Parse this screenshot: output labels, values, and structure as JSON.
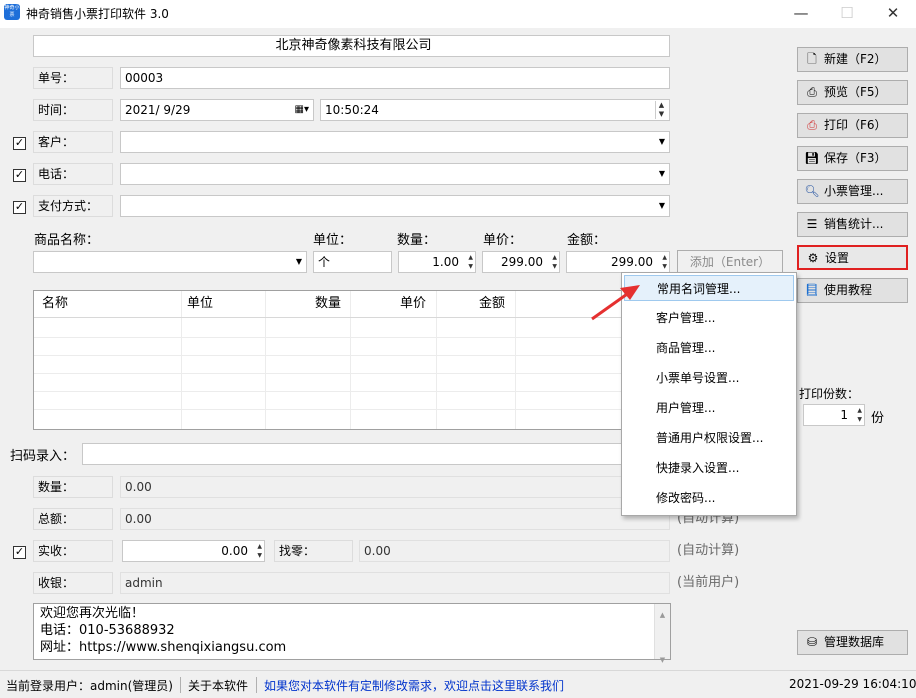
{
  "window": {
    "title": "神奇销售小票打印软件 3.0",
    "icon_label": "神奇小票",
    "minimize": "—",
    "maximize": "☐",
    "close": "✕"
  },
  "form": {
    "company": "北京神奇像素科技有限公司",
    "order_no_label": "单号：",
    "order_no": "00003",
    "time_label": "时间：",
    "date": "2021/  9/29",
    "time": "10:50:24",
    "customer_label": "客户：",
    "customer": "",
    "phone_label": "电话：",
    "phone": "",
    "payment_label": "支付方式：",
    "payment": "",
    "product_name_label": "商品名称：",
    "unit_label": "单位：",
    "qty_label": "数量：",
    "price_label": "单价：",
    "amount_label": "金额：",
    "product_name": "",
    "unit": "个",
    "qty": "1.00",
    "price": "299.00",
    "amount": "299.00",
    "add_button": "添加（Enter）"
  },
  "table": {
    "columns": [
      "名称",
      "单位",
      "数量",
      "单价",
      "金额"
    ],
    "rows": []
  },
  "lower": {
    "scan_label": "扫码录入：",
    "scan_value": "",
    "total_qty_label": "数量：",
    "total_qty": "0.00",
    "total_amount_label": "总额：",
    "total_amount": "0.00",
    "auto_calc_hint": "(自动计算)",
    "received_label": "实收：",
    "received": "0.00",
    "change_label": "找零：",
    "change": "0.00",
    "auto_calc_hint2": "(自动计算)",
    "cashier_label": "收银：",
    "cashier": "admin",
    "current_user_hint": "(当前用户)",
    "footer_lines": [
      "欢迎您再次光临！",
      "电话：010-53688932",
      "网址：https://www.shenqixiangsu.com"
    ]
  },
  "sidebar": {
    "buttons": [
      {
        "label": "新建（F2）",
        "icon": "new-doc-icon"
      },
      {
        "label": "预览（F5）",
        "icon": "preview-icon"
      },
      {
        "label": "打印（F6）",
        "icon": "printer-icon"
      },
      {
        "label": "保存（F3）",
        "icon": "save-icon"
      },
      {
        "label": "小票管理...",
        "icon": "search-icon"
      },
      {
        "label": "销售统计...",
        "icon": "list-icon"
      },
      {
        "label": "设置",
        "icon": "gear-icon"
      },
      {
        "label": "使用教程",
        "icon": "book-icon"
      }
    ],
    "print_copies_label": "打印份数：",
    "print_copies": "1",
    "copies_unit": "份",
    "db_button": "管理数据库"
  },
  "settings_menu": {
    "items": [
      "常用名词管理...",
      "客户管理...",
      "商品管理...",
      "小票单号设置...",
      "用户管理...",
      "普通用户权限设置...",
      "快捷录入设置...",
      "修改密码..."
    ]
  },
  "statusbar": {
    "login": "当前登录用户：admin(管理员)",
    "about": "关于本软件",
    "custom_link": "如果您对本软件有定制修改需求，欢迎点击这里联系我们",
    "datetime": "2021-09-29 16:04:10"
  },
  "colors": {
    "highlight_border": "#e02020",
    "arrow": "#e53030",
    "link": "#0033cc"
  }
}
